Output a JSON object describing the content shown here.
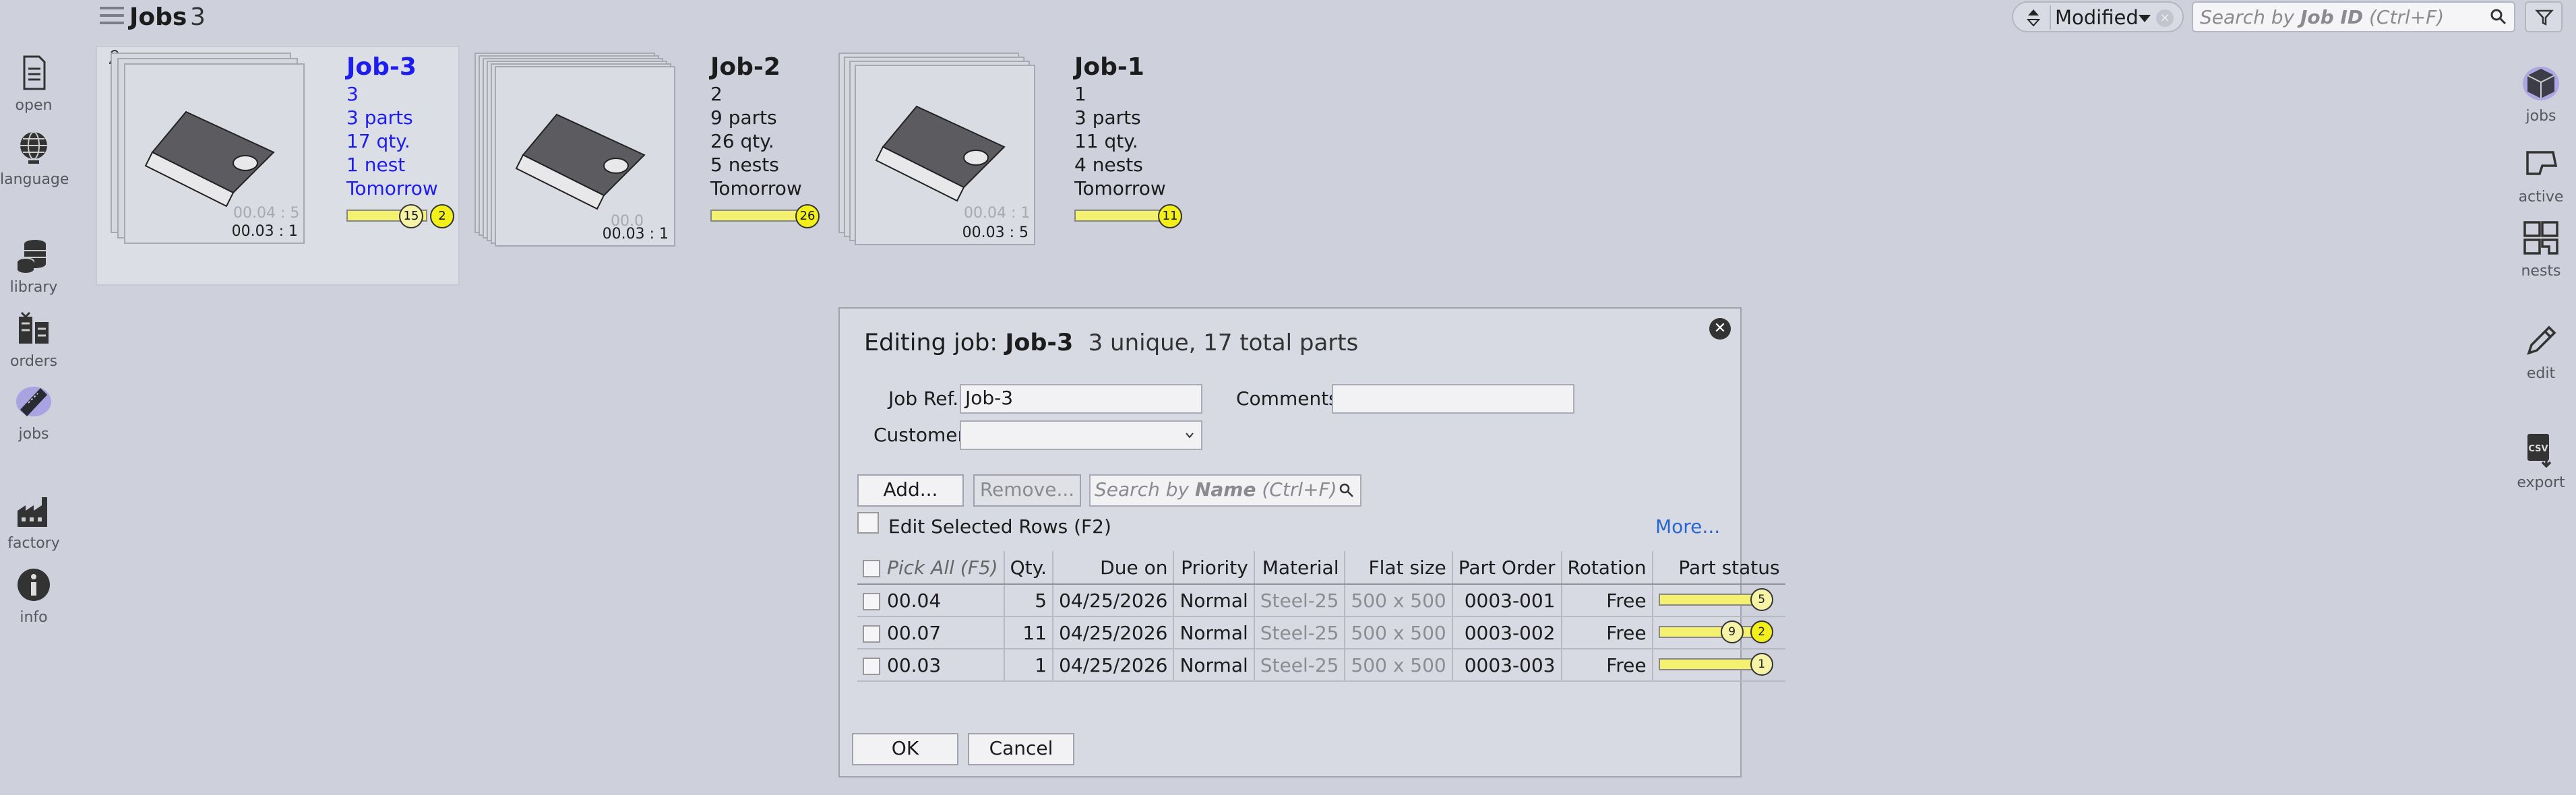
{
  "header": {
    "title": "Jobs",
    "count": "3",
    "sort_label": "Modified",
    "search_placeholder_prefix": "Search by ",
    "search_placeholder_bold": "Job ID",
    "search_placeholder_suffix": " (Ctrl+F)"
  },
  "left_nav": [
    {
      "label": "open",
      "icon": "document-icon"
    },
    {
      "label": "language",
      "icon": "globe-icon"
    },
    {
      "label": "library",
      "icon": "coins-stack-icon"
    },
    {
      "label": "orders",
      "icon": "orders-icon"
    },
    {
      "label": "jobs",
      "icon": "ticket-icon"
    },
    {
      "label": "factory",
      "icon": "factory-icon"
    },
    {
      "label": "info",
      "icon": "info-icon"
    }
  ],
  "right_nav": [
    {
      "label": "jobs",
      "icon": "box-icon"
    },
    {
      "label": "active",
      "icon": "machine-icon"
    },
    {
      "label": "nests",
      "icon": "nests-icon"
    },
    {
      "label": "edit",
      "icon": "pencil-icon"
    },
    {
      "label": "export",
      "icon": "csv-export-icon"
    }
  ],
  "jobs": [
    {
      "name": "Job-3",
      "ref": "3",
      "parts": "3 parts",
      "qty": "17 qty.",
      "nests": "1 nest",
      "due": "Tomorrow",
      "thumb_code": "00.03 : 1",
      "thumb_ghost": "00.04 : 5",
      "progress_badge_1": "15",
      "progress_badge_2": "2"
    },
    {
      "name": "Job-2",
      "ref": "2",
      "parts": "9 parts",
      "qty": "26 qty.",
      "nests": "5 nests",
      "due": "Tomorrow",
      "thumb_code": "00.03 : 1",
      "thumb_ghost": "00.0",
      "progress_badge_1": "26"
    },
    {
      "name": "Job-1",
      "ref": "1",
      "parts": "3 parts",
      "qty": "11 qty.",
      "nests": "4 nests",
      "due": "Tomorrow",
      "thumb_code": "00.03 : 5",
      "thumb_ghost": "00.04 : 1",
      "progress_badge_1": "11"
    }
  ],
  "dialog": {
    "title_prefix": "Editing job: ",
    "title_job": "Job-3",
    "subtitle": "3 unique, 17 total parts",
    "job_ref_label": "Job Ref.",
    "job_ref_value": "Job-3",
    "comments_label": "Comments",
    "comments_value": "",
    "customer_label": "Customer",
    "customer_value": "",
    "add_label": "Add...",
    "remove_label": "Remove...",
    "search_prefix": "Search by ",
    "search_bold": "Name",
    "search_suffix": " (Ctrl+F)",
    "edit_rows_label": "Edit Selected Rows (F2)",
    "more_label": "More...",
    "ok_label": "OK",
    "cancel_label": "Cancel",
    "columns": [
      "Pick All (F5)",
      "Qty.",
      "Due on",
      "Priority",
      "Material",
      "Flat size",
      "Part Order",
      "Rotation",
      "Part status"
    ],
    "rows": [
      {
        "part": "00.04",
        "qty": "5",
        "due": "04/25/2026",
        "priority": "Normal",
        "material": "Steel-25",
        "flat": "500 x 500",
        "order": "0003-001",
        "rotation": "Free",
        "status_badges": [
          "5"
        ]
      },
      {
        "part": "00.07",
        "qty": "11",
        "due": "04/25/2026",
        "priority": "Normal",
        "material": "Steel-25",
        "flat": "500 x 500",
        "order": "0003-002",
        "rotation": "Free",
        "status_badges": [
          "9",
          "2"
        ]
      },
      {
        "part": "00.03",
        "qty": "1",
        "due": "04/25/2026",
        "priority": "Normal",
        "material": "Steel-25",
        "flat": "500 x 500",
        "order": "0003-003",
        "rotation": "Free",
        "status_badges": [
          "1"
        ]
      }
    ]
  },
  "colors": {
    "accent_blue": "#1d1df0",
    "badge_yellow": "#f2ef1a",
    "link": "#2a66d0"
  }
}
